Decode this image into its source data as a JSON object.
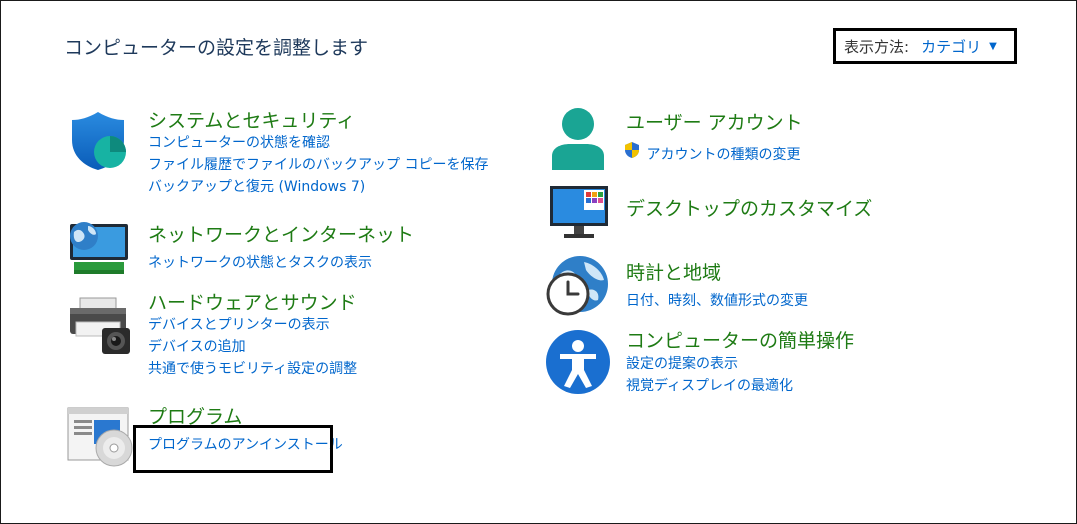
{
  "page": {
    "title": "コンピューターの設定を調整します"
  },
  "view": {
    "label": "表示方法:",
    "value": "カテゴリ"
  },
  "categories": {
    "system_security": {
      "title": "システムとセキュリティ",
      "links": [
        "コンピューターの状態を確認",
        "ファイル履歴でファイルのバックアップ コピーを保存",
        "バックアップと復元 (Windows 7)"
      ],
      "icon": "shield-icon"
    },
    "network": {
      "title": "ネットワークとインターネット",
      "links": [
        "ネットワークの状態とタスクの表示"
      ],
      "icon": "network-globe-icon"
    },
    "hardware_sound": {
      "title": "ハードウェアとサウンド",
      "links": [
        "デバイスとプリンターの表示",
        "デバイスの追加",
        "共通で使うモビリティ設定の調整"
      ],
      "icon": "printer-icon"
    },
    "programs": {
      "title": "プログラム",
      "links": [
        "プログラムのアンインストール"
      ],
      "icon": "programs-disc-icon"
    },
    "user_accounts": {
      "title": "ユーザー アカウント",
      "links": [
        "アカウントの種類の変更"
      ],
      "icon": "user-icon"
    },
    "appearance": {
      "title": "デスクトップのカスタマイズ",
      "links": [],
      "icon": "desktop-monitor-icon"
    },
    "clock_region": {
      "title": "時計と地域",
      "links": [
        "日付、時刻、数値形式の変更"
      ],
      "icon": "globe-clock-icon"
    },
    "ease_access": {
      "title": "コンピューターの簡単操作",
      "links": [
        "設定の提案の表示",
        "視覚ディスプレイの最適化"
      ],
      "icon": "accessibility-icon"
    }
  },
  "colors": {
    "category_title": "#1e7b14",
    "link": "#0066cc",
    "page_title": "#1e395b"
  }
}
